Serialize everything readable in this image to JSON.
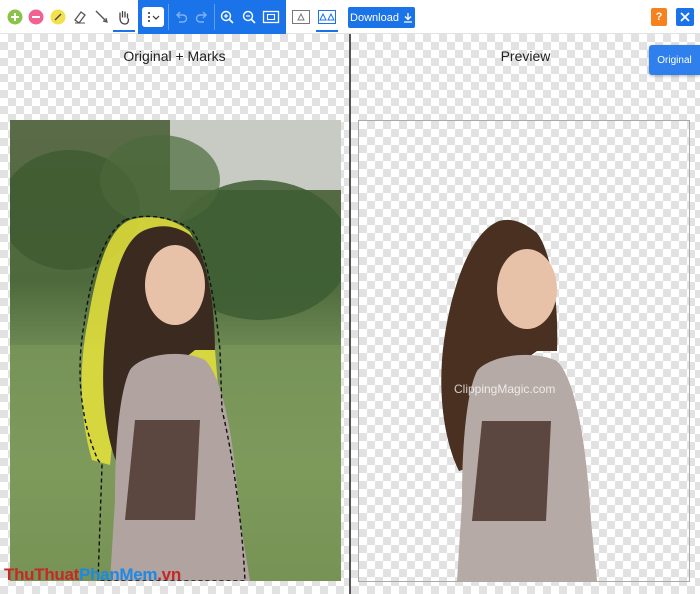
{
  "toolbar": {
    "download_label": "Download",
    "help_label": "?",
    "tools": [
      {
        "name": "add-icon",
        "color": "#4caf50"
      },
      {
        "name": "remove-icon",
        "color": "#f06292"
      },
      {
        "name": "marker-icon",
        "color": "#f2e14c"
      },
      {
        "name": "eraser-icon",
        "color": "#555555"
      },
      {
        "name": "scalpel-icon",
        "color": "#555555"
      },
      {
        "name": "hand-icon",
        "color": "#555555"
      }
    ]
  },
  "panels": {
    "left_title": "Original + Marks",
    "right_title": "Preview",
    "original_button": "Original"
  },
  "watermark": {
    "part1": "Thu",
    "part2": "Thuat",
    "part3": "PhanMem",
    "part4": ".vn"
  },
  "preview_overlay": "ClippingMagic.com",
  "colors": {
    "accent": "#1a73e8",
    "help": "#f5821f",
    "mark_yellow": "#e8e23a"
  }
}
